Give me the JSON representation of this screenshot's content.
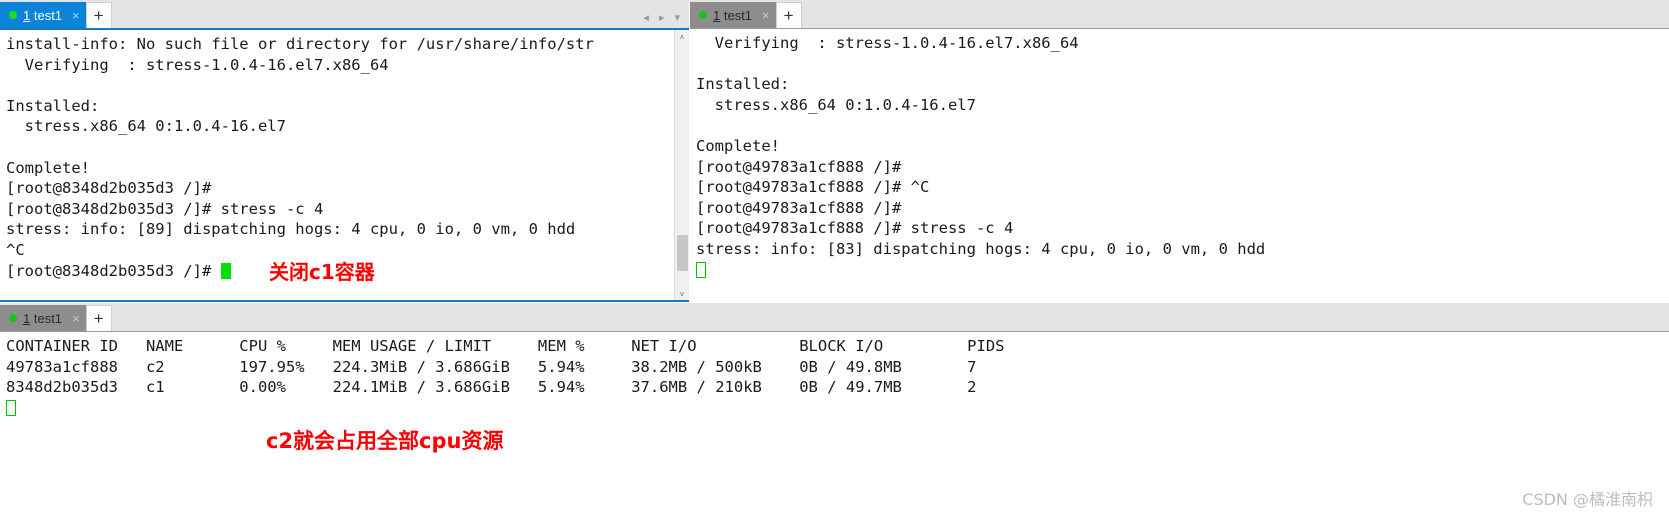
{
  "window": {
    "title": "MobaXterm terminal panes - docker stress test",
    "accent_blue": "#0a84d8",
    "inactive_tab_gray": "#8d8d8d",
    "annotation_red": "#ff0000",
    "cursor_green": "#00e000"
  },
  "panes": {
    "top_left": {
      "tab": {
        "dot": "green-status-dot",
        "number": "1",
        "name": " test1",
        "close": "×",
        "state": "active"
      },
      "new_tab_label": "+",
      "nav": {
        "prev": "◂",
        "next": "▸",
        "menu": "▾"
      },
      "scrollbar": {
        "up": "˄",
        "down": "˅"
      },
      "lines": [
        "install-info: No such file or directory for /usr/share/info/str",
        "  Verifying  : stress-1.0.4-16.el7.x86_64",
        "",
        "Installed:",
        "  stress.x86_64 0:1.0.4-16.el7",
        "",
        "Complete!",
        "[root@8348d2b035d3 /]#",
        "[root@8348d2b035d3 /]# stress -c 4",
        "stress: info: [89] dispatching hogs: 4 cpu, 0 io, 0 vm, 0 hdd",
        "^C"
      ],
      "prompt_line": "[root@8348d2b035d3 /]# ",
      "annotation": "关闭c1容器"
    },
    "top_right": {
      "tab": {
        "dot": "green-status-dot",
        "number": "1",
        "name": " test1",
        "close": "×",
        "state": "inactive"
      },
      "new_tab_label": "+",
      "lines": [
        "  Verifying  : stress-1.0.4-16.el7.x86_64",
        "",
        "Installed:",
        "  stress.x86_64 0:1.0.4-16.el7",
        "",
        "Complete!",
        "[root@49783a1cf888 /]#",
        "[root@49783a1cf888 /]# ^C",
        "[root@49783a1cf888 /]#",
        "[root@49783a1cf888 /]# stress -c 4",
        "stress: info: [83] dispatching hogs: 4 cpu, 0 io, 0 vm, 0 hdd"
      ]
    },
    "bottom": {
      "tab": {
        "dot": "green-status-dot",
        "number": "1",
        "name": " test1",
        "close": "×",
        "state": "inactive"
      },
      "new_tab_label": "+",
      "stats": {
        "header": "CONTAINER ID   NAME      CPU %     MEM USAGE / LIMIT     MEM %     NET I/O           BLOCK I/O         PIDS",
        "rows": [
          "49783a1cf888   c2        197.95%   224.3MiB / 3.686GiB   5.94%     38.2MB / 500kB    0B / 49.8MB       7",
          "8348d2b035d3   c1        0.00%     224.1MiB / 3.686GiB   5.94%     37.6MB / 210kB    0B / 49.7MB       2"
        ]
      },
      "annotation": "c2就会占用全部cpu资源"
    }
  },
  "watermark": "CSDN @橘淮南枳"
}
